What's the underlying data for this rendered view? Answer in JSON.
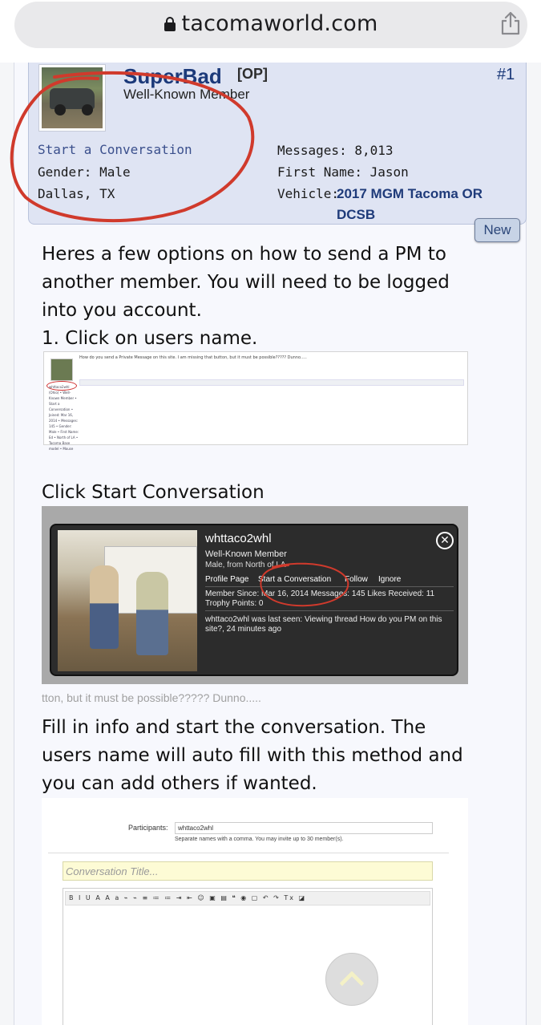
{
  "browser": {
    "url": "tacomaworld.com",
    "lock_icon": "lock-icon",
    "share_icon": "share-icon"
  },
  "post": {
    "username": "SuperBad",
    "op_tag": "[OP]",
    "post_number": "#1",
    "user_title": "Well-Known Member",
    "start_conversation": "Start a Conversation",
    "gender": "Gender: Male",
    "location": "Dallas, TX",
    "messages": "Messages: 8,013",
    "first_name": "First Name: Jason",
    "vehicle_label": "Vehicle:",
    "vehicle_value": "2017 MGM Tacoma OR DCSB",
    "new_badge": "New",
    "para1": "Heres a few options on how to send a PM to another member. You will need to be logged into you account.",
    "step1": "1. Click on users name.",
    "step2": "Click Start Conversation",
    "step3": "Fill in info and start the conversation. The users name will auto fill with this method and you can add others if wanted."
  },
  "screenshot1": {
    "header_text": "How do you send a Private Message on this site. I am missing that button, but it must be possible????? Dunno.....",
    "sidebar_text": "whttaco2whl (Ohio) • Well-Known Member • Start a Conversation • Joined: Mar 16, 2014 • Messages: 145 • Gender: Male • First Name: Ed • North of LA • Tacoma Base model • Mouse"
  },
  "popup": {
    "name": "whttaco2whl",
    "rank": "Well-Known Member",
    "location": "Male, from North of LA",
    "links": [
      "Profile Page",
      "Start a Conversation",
      "Follow",
      "Ignore"
    ],
    "stats": "Member Since: Mar 16, 2014  Messages: 145  Likes Received: 11  Trophy Points: 0",
    "last_seen": "whttaco2whl was last seen: Viewing thread How do you PM on this site?, 24 minutes ago",
    "close_symbol": "✕",
    "caption": "tton, but it must be possible????? Dunno....."
  },
  "form": {
    "participants_label": "Participants:",
    "participants_value": "whttaco2whl",
    "participants_hint": "Separate names with a comma. You may invite up to 30 member(s).",
    "title_placeholder": "Conversation Title...",
    "toolbar": "B I U A A a ⌁ ⌁ ≡ ≔ ≔ ⇥ ⇤ ☺ ▣ ▤ ❝ ◉ ▢ ↶ ↷  Tx ◪"
  },
  "colors": {
    "accent_blue": "#1c3a7a",
    "annotation_red": "#d03a2c",
    "card_bg": "#dfe4f3"
  }
}
